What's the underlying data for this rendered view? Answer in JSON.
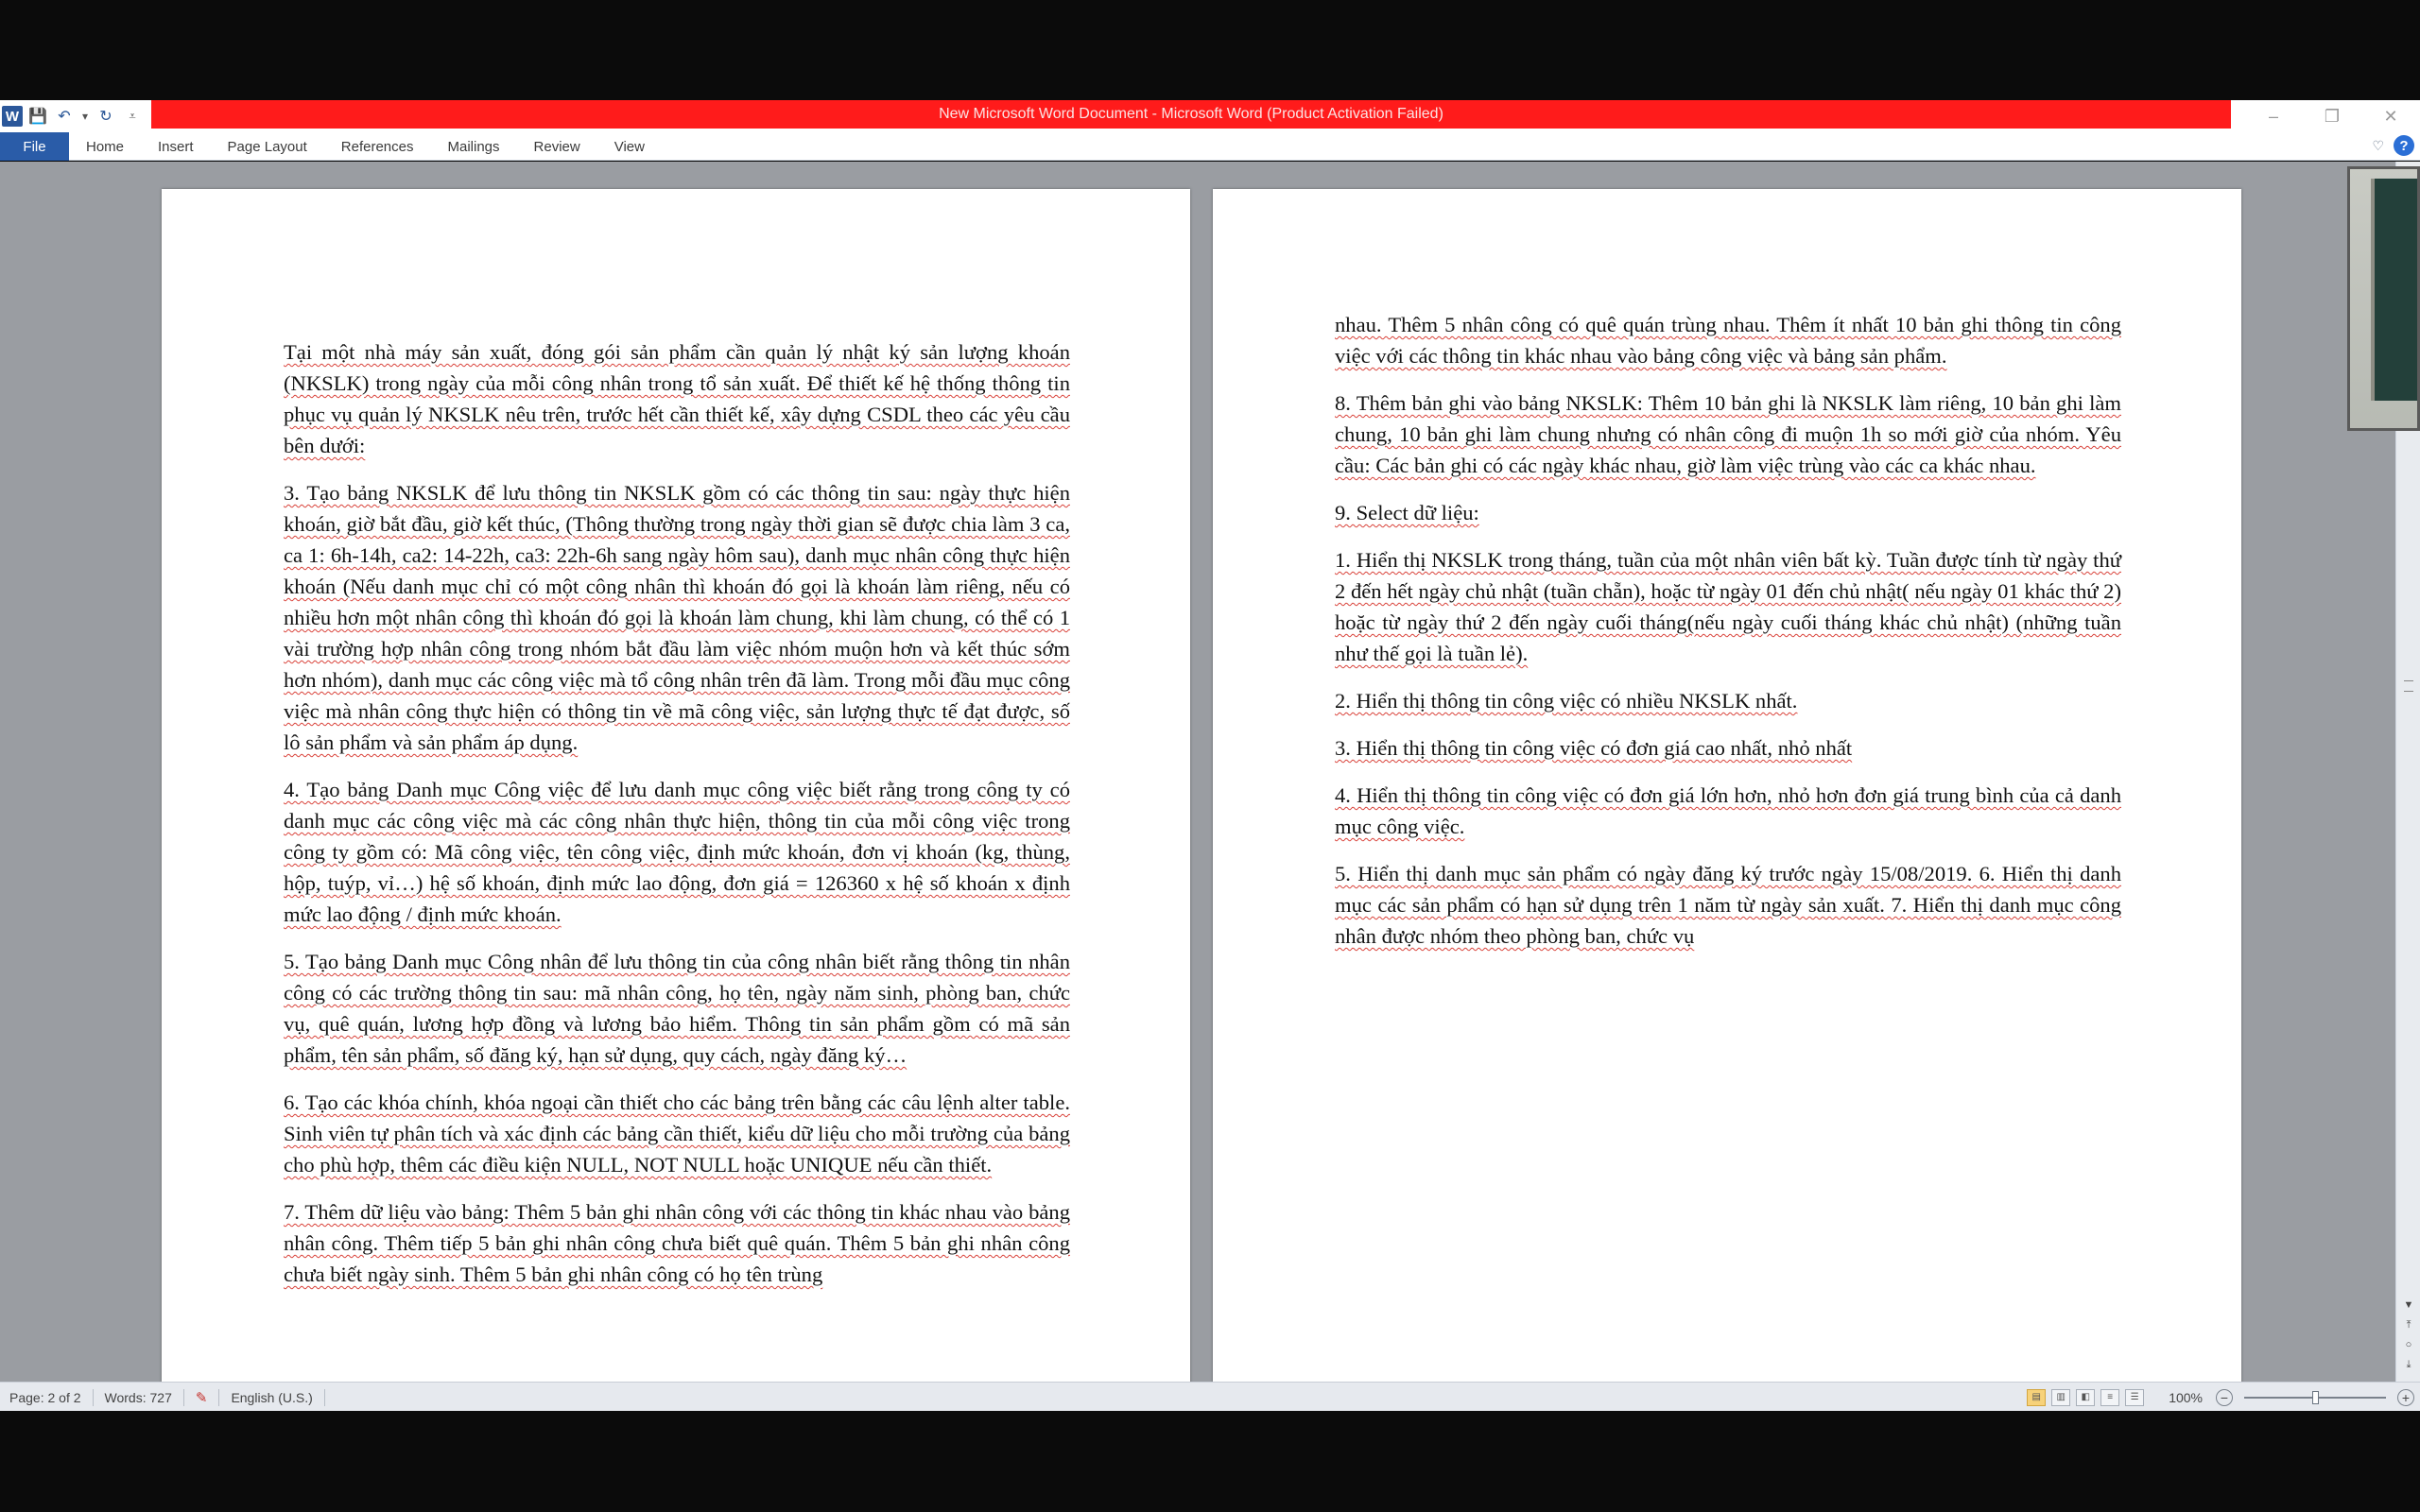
{
  "window": {
    "title": "New Microsoft Word Document  -  Microsoft Word (Product Activation Failed)",
    "title_bar_color": "#ff1b1b",
    "controls": {
      "minimize": "–",
      "restore": "❐",
      "close": "✕"
    }
  },
  "quick_access": {
    "app_icon": "W",
    "items": [
      "save-icon",
      "undo-icon",
      "redo-icon",
      "customize-icon"
    ],
    "save": "💾",
    "undo": "↶",
    "undo_dd": "▾",
    "redo": "↻",
    "customize": "⩡"
  },
  "ribbon": {
    "tabs": [
      "File",
      "Home",
      "Insert",
      "Page Layout",
      "References",
      "Mailings",
      "Review",
      "View"
    ],
    "minimize_icon": "♡",
    "help_icon": "?"
  },
  "pages": [
    {
      "paragraphs": [
        "Tại một nhà máy sản xuất, đóng gói sản phẩm cần quản lý nhật ký sản lượng khoán (NKSLK) trong ngày của mỗi công nhân trong tổ sản xuất. Để thiết kế hệ thống thông tin phục vụ quản lý NKSLK nêu trên, trước hết cần thiết kế, xây dựng CSDL theo các yêu cầu bên dưới:",
        "3. Tạo bảng NKSLK để lưu thông tin NKSLK gồm có các thông tin sau: ngày thực hiện khoán, giờ bắt đầu, giờ kết thúc, (Thông thường trong ngày thời gian sẽ được chia làm 3 ca, ca 1: 6h-14h, ca2: 14-22h, ca3: 22h-6h sang ngày hôm sau), danh mục nhân công thực hiện khoán (Nếu danh mục chỉ có một công nhân thì khoán đó gọi là khoán làm riêng, nếu có nhiều hơn một nhân công thì khoán đó gọi là khoán làm chung, khi làm chung, có thể có 1 vài trường hợp nhân công trong nhóm bắt đầu làm việc nhóm muộn hơn và kết thúc sớm hơn nhóm), danh mục các công việc mà tổ công nhân trên đã làm. Trong mỗi đầu mục công việc mà nhân công thực hiện có thông tin về mã công việc, sản lượng thực tế đạt được, số lô sản phẩm và sản phẩm áp dụng.",
        "4. Tạo bảng Danh mục Công việc để lưu danh mục công việc biết rằng trong công ty có danh mục các công việc mà các công nhân thực hiện, thông tin của mỗi công việc trong công ty gồm có: Mã công việc, tên công việc, định mức khoán, đơn vị khoán (kg, thùng, hộp, tuýp, vỉ…) hệ số khoán, định mức lao động, đơn giá = 126360 x hệ số khoán x định mức lao động / định mức khoán.",
        "5. Tạo bảng Danh mục Công nhân để lưu thông tin của công nhân biết rằng thông tin nhân công có các trường thông tin sau:  mã nhân công, họ tên, ngày năm sinh, phòng ban, chức vụ, quê quán, lương hợp đồng và lương bảo hiểm. Thông tin sản phẩm gồm có mã sản phẩm, tên sản phẩm, số đăng ký, hạn sử dụng, quy cách, ngày đăng ký…",
        "6. Tạo các khóa chính, khóa ngoại cần thiết cho các bảng trên bằng các câu lệnh alter table. Sinh viên tự phân tích và xác định các bảng cần thiết, kiểu dữ liệu cho mỗi trường của bảng cho phù hợp, thêm các điều kiện NULL, NOT NULL hoặc UNIQUE nếu cần thiết.",
        "7. Thêm dữ liệu vào bảng: Thêm 5 bản ghi nhân công với các thông tin khác nhau vào bảng nhân công. Thêm tiếp 5 bản ghi nhân công chưa biết quê quán. Thêm 5 bản ghi nhân công chưa biết ngày sinh. Thêm 5 bản ghi nhân công có họ tên trùng"
      ]
    },
    {
      "paragraphs": [
        "nhau. Thêm 5 nhân công có quê quán trùng nhau. Thêm ít nhất 10 bản ghi thông tin công việc với các thông tin khác nhau vào bảng công việc và bảng sản phẩm.",
        "8. Thêm bản ghi vào bảng NKSLK: Thêm 10 bản ghi là NKSLK làm riêng, 10 bản ghi làm chung, 10 bản ghi làm chung nhưng có nhân công đi muộn 1h so mới giờ của nhóm. Yêu cầu: Các bản ghi có các ngày khác nhau, giờ làm việc trùng vào các ca khác nhau.",
        "9. Select dữ liệu:",
        "1. Hiển thị NKSLK trong tháng, tuần của một nhân viên bất kỳ. Tuần được tính từ ngày thứ 2 đến hết ngày chủ nhật (tuần chẵn), hoặc từ ngày 01 đến chủ nhật( nếu ngày 01 khác thứ 2) hoặc từ ngày thứ 2 đến ngày cuối tháng(nếu ngày cuối tháng khác chủ nhật) (những tuần như thế gọi là tuần lẻ).",
        "2. Hiển thị thông tin công việc có nhiều NKSLK nhất.",
        "3. Hiển thị thông tin công việc có đơn giá cao nhất, nhỏ nhất",
        "4. Hiển thị thông tin công việc có đơn giá lớn hơn, nhỏ hơn đơn giá trung bình của cả danh mục công việc.",
        "5. Hiển thị danh mục sản phẩm có ngày đăng ký trước ngày 15/08/2019. 6. Hiển thị danh mục các sản phẩm có hạn sử dụng trên 1 năm từ ngày sản xuất. 7. Hiển thị danh mục công nhân được nhóm theo phòng ban, chức vụ"
      ]
    }
  ],
  "status": {
    "page": "Page: 2 of 2",
    "words": "Words: 727",
    "proofing_icon": "✎",
    "language": "English (U.S.)",
    "zoom": "100%",
    "zoom_out": "−",
    "zoom_in": "+"
  },
  "scrollbar": {
    "up": "▲",
    "down": "▼",
    "prev": "⤒",
    "select": "○",
    "next": "⤓"
  }
}
